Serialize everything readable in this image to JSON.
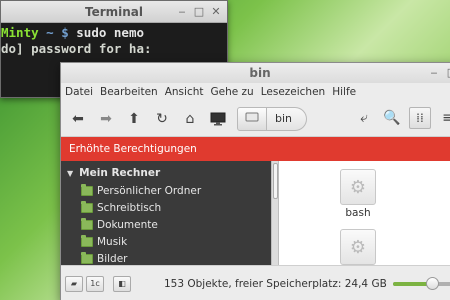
{
  "terminal": {
    "title": "Terminal",
    "prompt_user": "Minty",
    "prompt_path": " ~ $ ",
    "command": "sudo nemo",
    "line2": "do] password for ha:"
  },
  "nemo": {
    "title": "bin",
    "menu": [
      "Datei",
      "Bearbeiten",
      "Ansicht",
      "Gehe zu",
      "Lesezeichen",
      "Hilfe"
    ],
    "breadcrumb": {
      "current": "bin"
    },
    "banner": "Erhöhte Berechtigungen",
    "sidebar": {
      "header": "Mein Rechner",
      "items": [
        "Persönlicher Ordner",
        "Schreibtisch",
        "Dokumente",
        "Musik",
        "Bilder"
      ]
    },
    "files": [
      {
        "label": "bash"
      },
      {
        "label": ""
      }
    ],
    "status": {
      "text": "153 Objekte, freier Speicherplatz: 24,4 GB",
      "zoom_fraction": 0.55
    }
  },
  "colors": {
    "banner": "#e03a2f",
    "sidebar_bg": "#3a3a3a",
    "prompt_green": "#8ae234",
    "accent_green": "#7cb342"
  }
}
